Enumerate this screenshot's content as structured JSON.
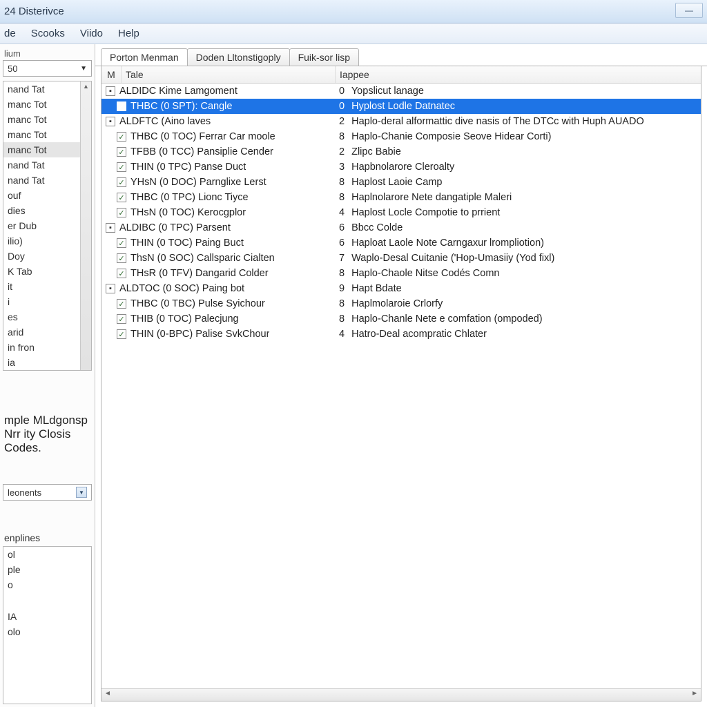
{
  "window": {
    "title": "24 Disterivce"
  },
  "menu": {
    "items": [
      "de",
      "Scooks",
      "Viido",
      "Help"
    ]
  },
  "sidebar": {
    "top_label": "lium",
    "combo_value": "50",
    "list": [
      "nand Tat",
      "manc Tot",
      "manc Tot",
      "manc Tot",
      "manc Tot",
      "nand Tat",
      "nand Tat",
      "ouf",
      "dies",
      "er Dub",
      "ilio)",
      "Doy",
      "K Tab",
      "it",
      "i",
      "es",
      "arid",
      "in fron",
      "ia"
    ],
    "selected_index": 4,
    "status_text": "mple MLdgonsp Nrr ity Closis Codes.",
    "combo2_value": "leonents",
    "lower_label": "enplines",
    "lower_items": [
      "ol",
      "ple",
      "o",
      "",
      "",
      "",
      "",
      "IA",
      "olo"
    ]
  },
  "tabs": [
    {
      "label": "Porton Menman",
      "active": true
    },
    {
      "label": "Doden Lltonstigoply",
      "active": false
    },
    {
      "label": "Fuik-sor lisp",
      "active": false
    }
  ],
  "columns": {
    "toggle": "M",
    "title": "Tale",
    "desc": "Iappee"
  },
  "groups": [
    {
      "title": "ALDIDC Kime Lamgoment",
      "num": "0",
      "desc": "Yopslicut lanage",
      "children": [
        {
          "title": "THBC (0 SPT): Cangle",
          "num": "0",
          "desc": "Hyplost Lodle Datnatec",
          "selected": true
        }
      ]
    },
    {
      "title": "ALDFTC (Aino laves",
      "num": "2",
      "desc": "Haplo-deral alformattic dive nasis of The DTCc with Huph AUADO",
      "children": [
        {
          "title": "THBC (0 TOC) Ferrar Car moole",
          "num": "8",
          "desc": "Haplo-Chanie Composie Seove Hidear Corti)"
        },
        {
          "title": "TFBB (0 TCC) Pansiplie Cender",
          "num": "2",
          "desc": "Zlipc Babie"
        },
        {
          "title": "THIN (0 TPC) Panse Duct",
          "num": "3",
          "desc": "Hapbnolarore Cleroalty"
        },
        {
          "title": "YHsN (0 DOC) Parnglixe Lerst",
          "num": "8",
          "desc": "Haplost Laoie Camp"
        },
        {
          "title": "THBC (0 TPC) Lionc Tiyce",
          "num": "8",
          "desc": "Haplnolarore Nete dangatiple Maleri"
        },
        {
          "title": "THsN (0 TOC) Kerocgplor",
          "num": "4",
          "desc": "Haplost Locle Compotie to prrient"
        }
      ]
    },
    {
      "title": "ALDIBC (0 TPC) Parsent",
      "num": "6",
      "desc": "Bbcc Colde",
      "children": [
        {
          "title": "THIN (0 TOC) Paing Buct",
          "num": "6",
          "desc": "Haploat Laole Note Carngaxur lrompliotion)"
        },
        {
          "title": "ThsN (0 SOC) Callsparic Cialten",
          "num": "7",
          "desc": "Waplo-Desal Cuitanie ('Hop-Umasiiy (Yod fixl)"
        },
        {
          "title": "THsR (0 TFV) Dangarid Colder",
          "num": "8",
          "desc": "Haplo-Chaole Nitse Codés Comn"
        }
      ]
    },
    {
      "title": "ALDTOC (0 SOC) Paing bot",
      "num": "9",
      "desc": "Hapt Bdate",
      "children": [
        {
          "title": "THBC (0 TBC) Pulse Syichour",
          "num": "8",
          "desc": "Haplmolaroie Crlorfy"
        },
        {
          "title": "THIB (0 TOC) Palecjung",
          "num": "8",
          "desc": "Haplo-Chanle Nete e comfation (ompoded)"
        },
        {
          "title": "THIN (0-BPC) Palise SvkChour",
          "num": "4",
          "desc": "Hatro-Deal acompratic Chlater"
        }
      ]
    }
  ]
}
